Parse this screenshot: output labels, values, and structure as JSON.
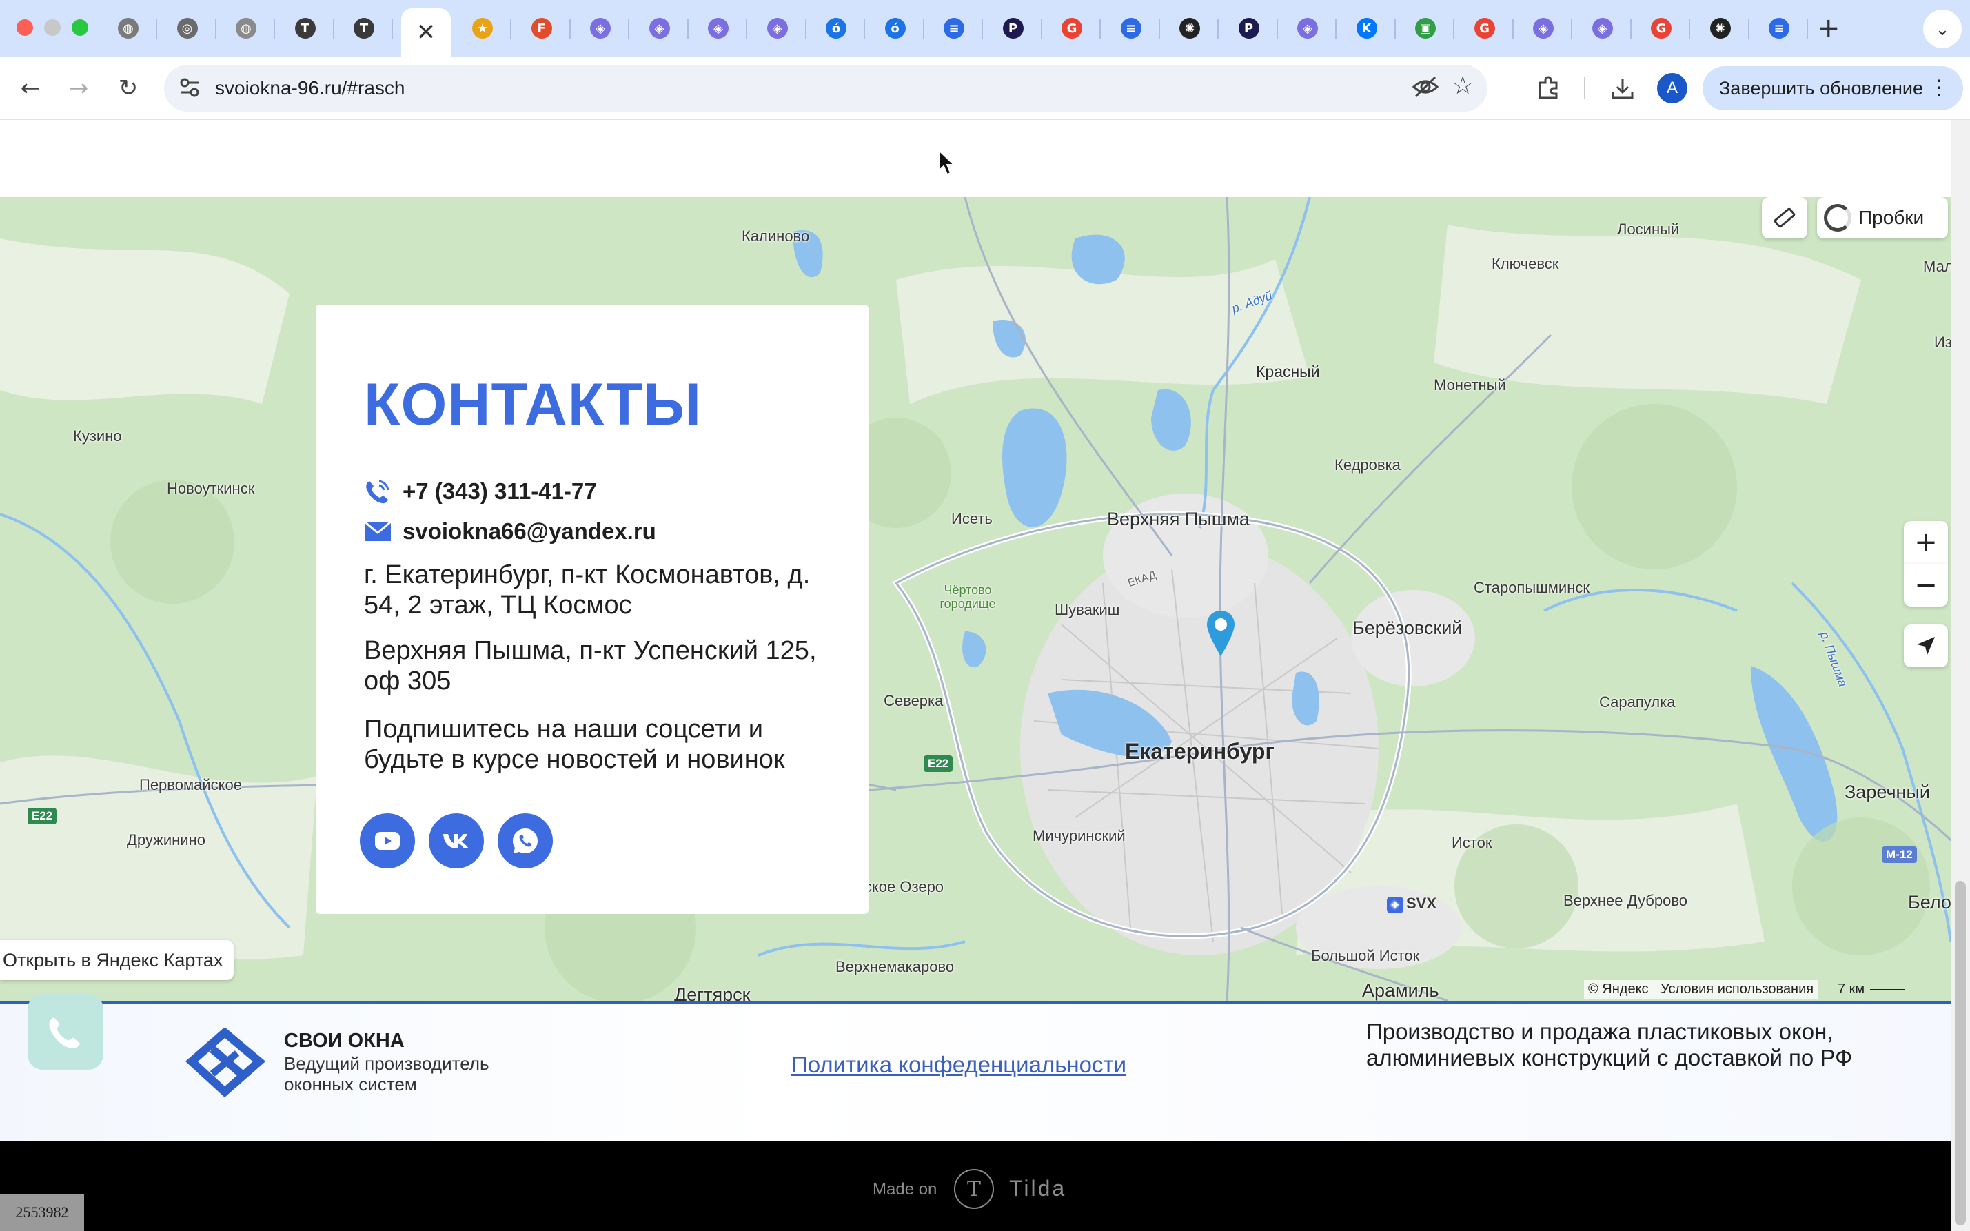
{
  "browser": {
    "url": "svoiokna-96.ru/#rasch",
    "update_button": "Завершить обновление",
    "profile_initial": "A",
    "tabs": [
      {
        "icon": "globe-icon",
        "color": "#7a7a7a",
        "glyph": "◍"
      },
      {
        "icon": "chrome-icon",
        "color": "#6b6b6b",
        "glyph": "◎"
      },
      {
        "icon": "globe-icon",
        "color": "#8a8a8a",
        "glyph": "◍"
      },
      {
        "icon": "tilda-icon",
        "color": "#3a3a3a",
        "glyph": "T"
      },
      {
        "icon": "tilda-icon",
        "color": "#3a3a3a",
        "glyph": "T"
      },
      {
        "icon": "star-icon",
        "color": "#e8a317",
        "glyph": "★"
      },
      {
        "icon": "figma-icon",
        "color": "#e24b2b",
        "glyph": "F"
      },
      {
        "icon": "diamond-icon",
        "color": "#7b6ee0",
        "glyph": "◈"
      },
      {
        "icon": "diamond-icon",
        "color": "#7b6ee0",
        "glyph": "◈"
      },
      {
        "icon": "diamond-icon",
        "color": "#7b6ee0",
        "glyph": "◈"
      },
      {
        "icon": "diamond-icon",
        "color": "#7b6ee0",
        "glyph": "◈"
      },
      {
        "icon": "ok-icon",
        "color": "#1b73e8",
        "glyph": "ó"
      },
      {
        "icon": "ok-icon",
        "color": "#1b73e8",
        "glyph": "ó"
      },
      {
        "icon": "doc-icon",
        "color": "#2d6be6",
        "glyph": "≡"
      },
      {
        "icon": "p-icon",
        "color": "#1d1a4f",
        "glyph": "P"
      },
      {
        "icon": "google-icon",
        "color": "#ea4335",
        "glyph": "G"
      },
      {
        "icon": "doc-icon",
        "color": "#2d6be6",
        "glyph": "≡"
      },
      {
        "icon": "openai-icon",
        "color": "#222222",
        "glyph": "✺"
      },
      {
        "icon": "p-icon",
        "color": "#1d1a4f",
        "glyph": "P"
      },
      {
        "icon": "diamond-icon",
        "color": "#7b6ee0",
        "glyph": "◈"
      },
      {
        "icon": "vk-icon",
        "color": "#0077ff",
        "glyph": "K"
      },
      {
        "icon": "colorful-icon",
        "color": "#2f9e44",
        "glyph": "▣"
      },
      {
        "icon": "google-icon",
        "color": "#ea4335",
        "glyph": "G"
      },
      {
        "icon": "diamond-icon",
        "color": "#7b6ee0",
        "glyph": "◈"
      },
      {
        "icon": "diamond-icon",
        "color": "#7b6ee0",
        "glyph": "◈"
      },
      {
        "icon": "google-icon",
        "color": "#ea4335",
        "glyph": "G"
      },
      {
        "icon": "openai-icon",
        "color": "#222222",
        "glyph": "✺"
      },
      {
        "icon": "doc-icon",
        "color": "#2d6be6",
        "glyph": "≡"
      }
    ]
  },
  "contacts": {
    "title": "КОНТАКТЫ",
    "phone": "+7 (343) 311-41-77",
    "email": "svoiokna66@yandex.ru",
    "address1": "г. Екатеринбург, п-кт Космонавтов, д. 54, 2 этаж, ТЦ Космос",
    "address2": "Верхняя Пышма, п-кт Успенский 125, оф 305",
    "subscribe": "Подпишитесь на наши соцсети и будьте в курсе новостей и новинок",
    "accent_color": "#3d6be0"
  },
  "map": {
    "open_button": "Открыть в Яндекс Картах",
    "traffic": "Пробки",
    "copyright": "© Яндекс",
    "terms": "Условия использования",
    "scale": "7 км",
    "labels": {
      "ekaterinburg": "Екатеринбург",
      "verkhnyaya_pyshma": "Верхняя Пышма",
      "berezovsky": "Берёзовский",
      "aramil": "Арамиль",
      "zarechny": "Заречный",
      "beloyarsky": "Бело",
      "kalinovo": "Калиново",
      "losiny": "Лосиный",
      "klyuchevsk": "Ключевск",
      "mal": "Мал",
      "iz": "Из",
      "krasny": "Красный",
      "monetny": "Монетный",
      "kedrovka": "Кедровка",
      "kuzino": "Кузино",
      "novoutkinsk": "Новоуткинск",
      "iset": "Исеть",
      "chertovo": "Чёртово городище",
      "shuvakish": "Шувакиш",
      "staropyshminsk": "Старопышминск",
      "severka": "Северка",
      "sarapulka": "Сарапулка",
      "pervomayskoe": "Первомайское",
      "druzhinino": "Дружинино",
      "michurinsky": "Мичуринский",
      "istok": "Исток",
      "verkhnee_dubrovo": "Верхнее Дуброво",
      "svx": "SVX",
      "bolshoy_istok": "Большой Исток",
      "verkhnemakarovo": "Верхнемакарово",
      "degtyarsk": "Дегтярск",
      "sovskoe_ozero": "ссовское Озеро",
      "r_aduy": "р. Адуй",
      "r_pyshma": "р. Пышма",
      "ekad": "ЕКАД",
      "e22": "E22",
      "m12": "M-12"
    }
  },
  "footer": {
    "brand_name": "СВОИ ОКНА",
    "brand_sub": "Ведущий производитель оконных систем",
    "policy_link": "Политика конфеденциальности",
    "description": "Производство и продажа пластиковых окон, алюминиевых конструкций с доставкой по РФ",
    "made_on": "Made on",
    "tilda": "Tilda",
    "page_id": "2553982"
  }
}
